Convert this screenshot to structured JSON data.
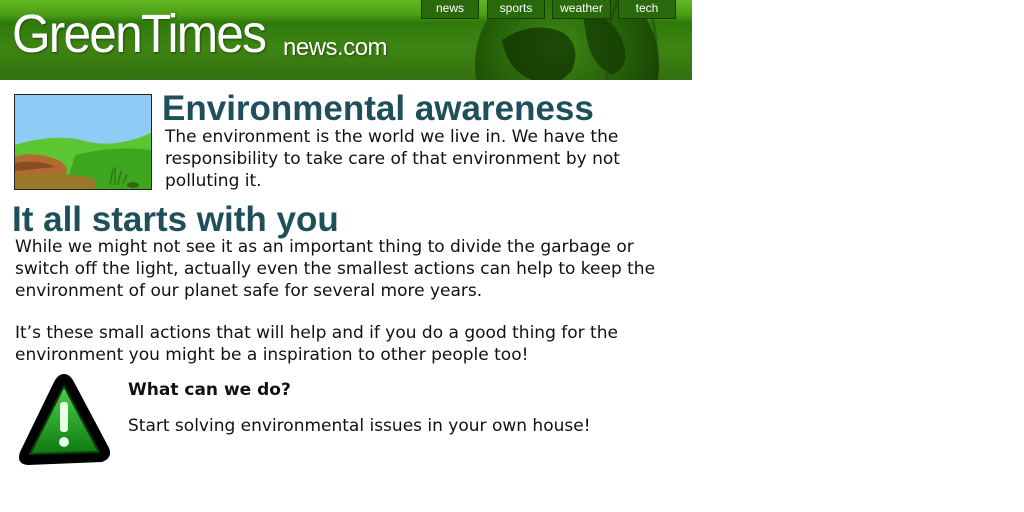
{
  "header": {
    "logo_main": "GreenTimes",
    "logo_sub": "news.com",
    "nav": [
      {
        "label": "news"
      },
      {
        "label": "sports"
      },
      {
        "label": "weather"
      },
      {
        "label": "tech"
      }
    ],
    "colors": {
      "banner": "#3d8512",
      "banner_light": "#62b823",
      "nav_button": "#2a6a0c"
    }
  },
  "article": {
    "title": "Environmental awareness",
    "intro": "The environment is the world we live in. We have the responsibility to take care of that environment by not polluting it.",
    "section_title": "It all starts with you",
    "paragraph1": "While we might not see it as an important thing to divide the garbage or switch off the light, actually even the smallest actions can help to keep the environment of our planet safe for several more years.",
    "paragraph2": "It’s these small actions that will help and if you do a good thing for the environment you might be a inspiration to other people too!",
    "heading_color": "#1e4f5a"
  },
  "tip": {
    "icon": "warning-icon",
    "title": "What can we do?",
    "text": "Start solving environmental issues in your own house!"
  }
}
